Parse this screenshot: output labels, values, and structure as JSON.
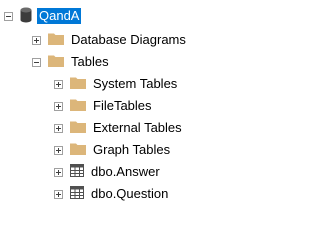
{
  "tree": {
    "database": {
      "label": "QandA",
      "icon": "database-icon",
      "expanded": true,
      "selected": true
    },
    "database_diagrams": {
      "label": "Database Diagrams",
      "icon": "folder-icon",
      "expanded": false
    },
    "tables": {
      "label": "Tables",
      "icon": "folder-icon",
      "expanded": true
    },
    "system_tables": {
      "label": "System Tables",
      "icon": "folder-icon",
      "expanded": false
    },
    "file_tables": {
      "label": "FileTables",
      "icon": "folder-icon",
      "expanded": false
    },
    "external_tables": {
      "label": "External Tables",
      "icon": "folder-icon",
      "expanded": false
    },
    "graph_tables": {
      "label": "Graph Tables",
      "icon": "folder-icon",
      "expanded": false
    },
    "answer_table": {
      "label": "dbo.Answer",
      "icon": "table-icon",
      "expanded": false
    },
    "question_table": {
      "label": "dbo.Question",
      "icon": "table-icon",
      "expanded": false
    }
  },
  "colors": {
    "selection": "#0078d7",
    "folder": "#dcb67a",
    "database": "#3c3c3c",
    "table": "#505050"
  }
}
